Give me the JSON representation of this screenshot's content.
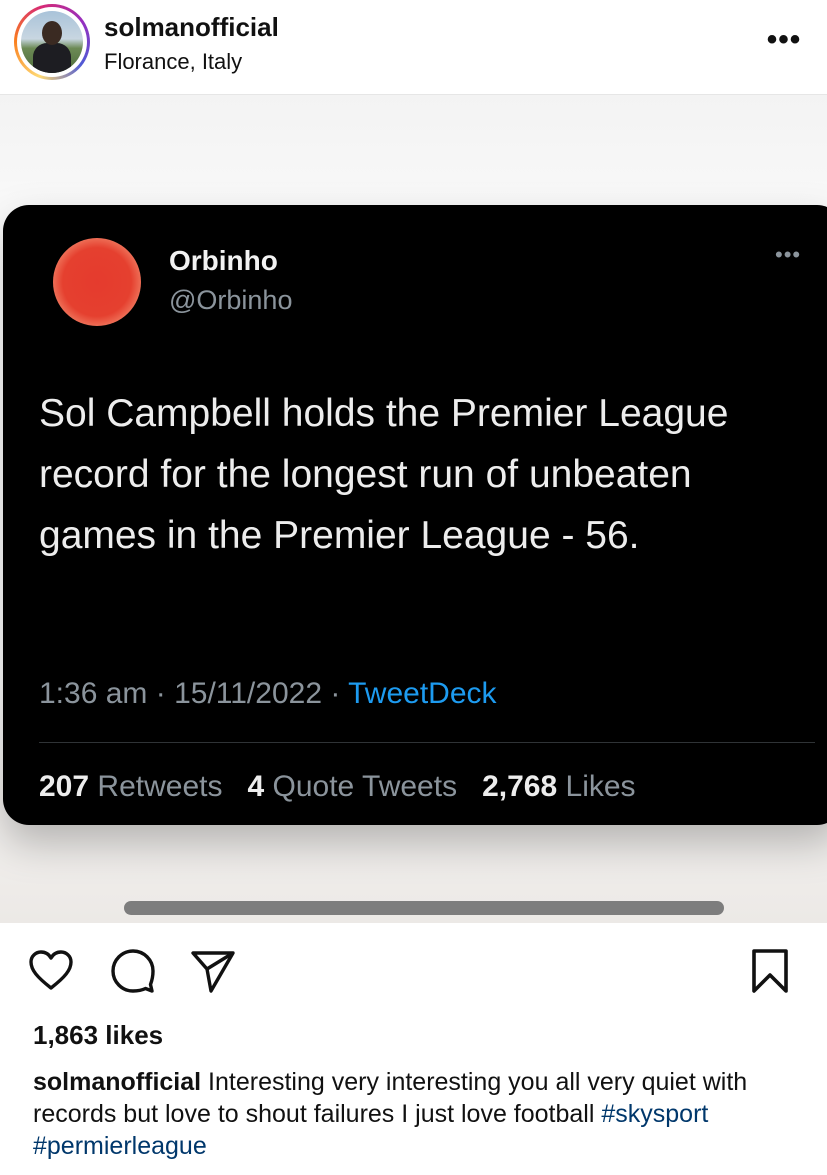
{
  "post": {
    "username": "solmanofficial",
    "location": "Florance, Italy",
    "more_icon": "more-horizontal-icon",
    "likes": "1,863 likes",
    "caption_user": "solmanofficial",
    "caption_text": " Interesting very interesting you all very quiet with records but love to  shout failures I just love football ",
    "hashtags": [
      "#skysport",
      "#permierleague"
    ]
  },
  "tweet": {
    "name": "Orbinho",
    "handle": "@Orbinho",
    "text": "Sol Campbell holds the Premier League record for the longest run of unbeaten games in the Premier League - 56.",
    "time": "1:36 am",
    "date": "15/11/2022",
    "source": "TweetDeck",
    "retweets_count": "207",
    "retweets_label": "Retweets",
    "quotes_count": "4",
    "quotes_label": "Quote Tweets",
    "likes_count": "2,768",
    "likes_label": "Likes"
  },
  "actions": {
    "like": "heart-icon",
    "comment": "comment-icon",
    "share": "share-icon",
    "save": "bookmark-icon"
  },
  "colors": {
    "hashtag": "#00376b",
    "tweet_link": "#1d9bf0",
    "tweet_bg": "#000000"
  }
}
